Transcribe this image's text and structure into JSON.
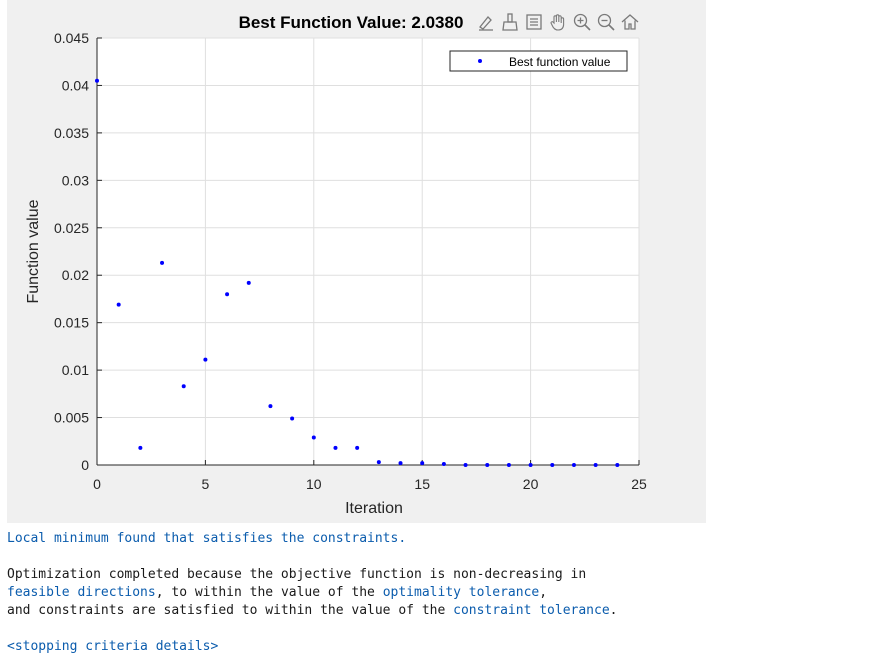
{
  "chart_data": {
    "type": "scatter",
    "title": "Best Function Value: 2.0380",
    "xlabel": "Iteration",
    "ylabel": "Function value",
    "xlim": [
      0,
      25
    ],
    "ylim": [
      0,
      0.045
    ],
    "xticks": [
      0,
      5,
      10,
      15,
      20,
      25
    ],
    "yticks": [
      0,
      0.005,
      0.01,
      0.015,
      0.02,
      0.025,
      0.03,
      0.035,
      0.04,
      0.045
    ],
    "ytick_labels": [
      "0",
      "0.005",
      "0.01",
      "0.015",
      "0.02",
      "0.025",
      "0.03",
      "0.035",
      "0.04",
      "0.045"
    ],
    "grid": true,
    "legend_position": "top-right",
    "series": [
      {
        "name": "Best function value",
        "color": "#0000ff",
        "x": [
          0,
          1,
          2,
          3,
          4,
          5,
          6,
          7,
          8,
          9,
          10,
          11,
          12,
          13,
          14,
          15,
          16,
          17,
          18,
          19,
          20,
          21,
          22,
          23,
          24
        ],
        "y": [
          0.0405,
          0.0169,
          0.0018,
          0.0213,
          0.0083,
          0.0111,
          0.018,
          0.0192,
          0.0062,
          0.0049,
          0.0029,
          0.0018,
          0.0018,
          0.0003,
          0.0002,
          0.0002,
          0.0001,
          0.0,
          0.0,
          0.0,
          0.0,
          0.0,
          0.0,
          0.0,
          0.0
        ]
      }
    ]
  },
  "toolbar": {
    "items": [
      {
        "name": "edit-plot-icon"
      },
      {
        "name": "brush-icon"
      },
      {
        "name": "data-tips-icon"
      },
      {
        "name": "pan-icon"
      },
      {
        "name": "zoom-in-icon"
      },
      {
        "name": "zoom-out-icon"
      },
      {
        "name": "home-icon"
      }
    ]
  },
  "console": {
    "exit_message": "Local minimum found that satisfies the constraints.",
    "line1": "Optimization completed because the objective function is non-decreasing in ",
    "link_feasible": "feasible directions",
    "line2_mid": ", to within the value of the ",
    "link_optimality": "optimality tolerance",
    "line2_end": ",",
    "line3_start": "and constraints are satisfied to within the value of the ",
    "link_constraint": "constraint tolerance",
    "line3_end": ".",
    "stopping_link": "<stopping criteria details>"
  }
}
